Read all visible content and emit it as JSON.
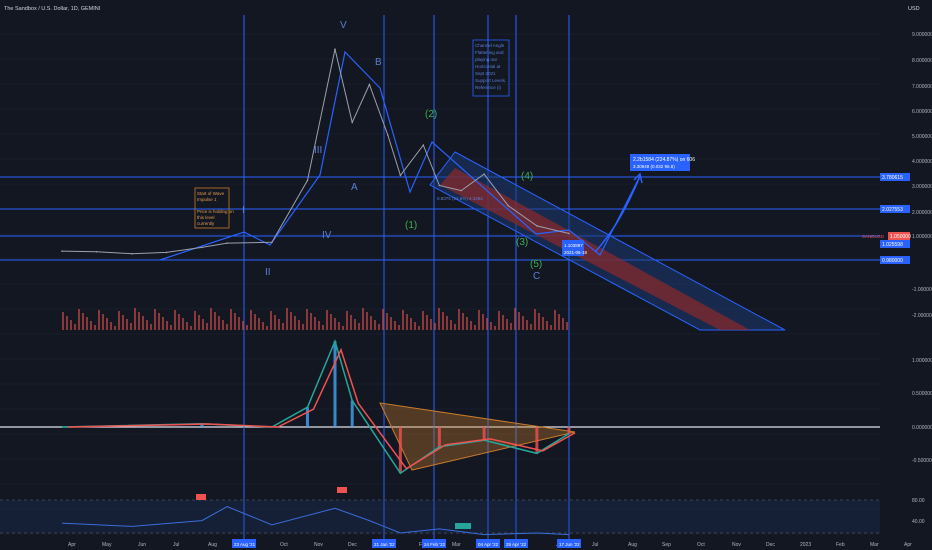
{
  "header": {
    "title": "The Sandbox / U.S. Dollar, 1D, GEMINI"
  },
  "axis": {
    "currency": "USD",
    "price_ticks": [
      "9.000000",
      "8.000000",
      "7.000000",
      "6.000000",
      "5.000000",
      "4.000000",
      "3.000000",
      "2.000000",
      "1.000000",
      "-1.000000",
      "-2.000000"
    ],
    "price_badges": [
      "3.780615",
      "2.027553",
      "1.025598",
      "0.980000"
    ],
    "current_price_badge": "1.050000",
    "current_price_label": "SANDUSD",
    "macd_ticks": [
      "1.000000",
      "0.500000",
      "0.000000",
      "-0.500000"
    ],
    "rsi_ticks": [
      "80.00",
      "40.00"
    ],
    "months": [
      "Apr",
      "May",
      "Jun",
      "Jul",
      "Aug",
      "Oct",
      "Nov",
      "Dec",
      "Feb",
      "Mar",
      "Jun",
      "Jul",
      "Aug",
      "Sep",
      "Oct",
      "Nov",
      "Dec",
      "2023",
      "Feb",
      "Mar",
      "Apr"
    ],
    "date_badges": [
      "23 Aug '21",
      "21 Jan '22",
      "24 Feb '22",
      "04 Apr '22",
      "25 Apr '22",
      "17 Jun '22"
    ]
  },
  "annotations": {
    "note_left": [
      "Start of Wave",
      "Impulse 1",
      "",
      "Price is holding on",
      "this level",
      "currently"
    ],
    "note_right": [
      "Channel Angle",
      "Flattening and",
      "playing out",
      "Horizontal at",
      "Sept 2021",
      "Support Levels.",
      "Reference (i)"
    ],
    "target_box": [
      "2.2b1584 (224.87%) on 606",
      "3.30949 (0.032 96.8)"
    ],
    "range_label": "0.8375 (54.6%) 4.3462",
    "current_box": [
      "1.103897",
      "2021-06-18"
    ],
    "waves": {
      "V": "V",
      "B": "B",
      "III": "III",
      "A": "A",
      "IV": "IV",
      "I": "I",
      "II": "II",
      "g2": "(2)",
      "g1": "(1)",
      "g4": "(4)",
      "g3": "(3)",
      "g5": "(5)",
      "C": "C"
    },
    "rsi_marks": [
      "Sell",
      "Sell",
      "Buy"
    ]
  },
  "colors": {
    "background": "#131722",
    "grid": "#1e2230",
    "price": "#9aa0ad",
    "blue_line": "#2962ff",
    "macd_line": "#26a69a",
    "signal_line": "#ef5350",
    "rsi_line": "#3a6dde",
    "channel_fill": "#1c3b73",
    "red_channel": "#8b2a2a"
  },
  "chart_data": {
    "type": "line",
    "title": "The Sandbox / U.S. Dollar, 1D, GEMINI",
    "price_series": {
      "name": "SANDUSD",
      "x": [
        "2021-04-01",
        "2021-05-01",
        "2021-06-01",
        "2021-07-01",
        "2021-08-01",
        "2021-08-23",
        "2021-10-01",
        "2021-11-01",
        "2021-11-25",
        "2021-12-10",
        "2021-12-25",
        "2022-01-10",
        "2022-01-21",
        "2022-02-10",
        "2022-02-24",
        "2022-03-15",
        "2022-04-04",
        "2022-04-25",
        "2022-05-20",
        "2022-06-17"
      ],
      "y": [
        0.4,
        0.38,
        0.3,
        0.35,
        0.55,
        0.72,
        0.75,
        3.2,
        8.4,
        5.5,
        7.0,
        5.0,
        3.4,
        4.6,
        3.0,
        2.8,
        3.45,
        2.2,
        1.4,
        1.1
      ]
    },
    "rsi_series": {
      "name": "RSI",
      "x": [
        "2021-04-01",
        "2021-06-01",
        "2021-08-01",
        "2021-08-23",
        "2021-10-01",
        "2021-11-25",
        "2021-12-25",
        "2022-01-21",
        "2022-02-24",
        "2022-04-04",
        "2022-05-20",
        "2022-06-17"
      ],
      "y": [
        52,
        48,
        55,
        72,
        50,
        70,
        55,
        40,
        45,
        38,
        40,
        38
      ]
    },
    "macd_series": {
      "name": "MACD",
      "x": [
        "2021-04-01",
        "2021-08-01",
        "2021-10-01",
        "2021-11-01",
        "2021-11-25",
        "2021-12-10",
        "2022-01-21",
        "2022-02-24",
        "2022-04-04",
        "2022-05-20",
        "2022-06-17"
      ],
      "y": [
        0.0,
        0.05,
        0.0,
        0.3,
        1.3,
        0.4,
        -0.7,
        -0.3,
        -0.2,
        -0.4,
        -0.1
      ]
    },
    "xlim": [
      "2021-04-01",
      "2023-04-01"
    ],
    "ylim": [
      -2.5,
      9.5
    ]
  }
}
